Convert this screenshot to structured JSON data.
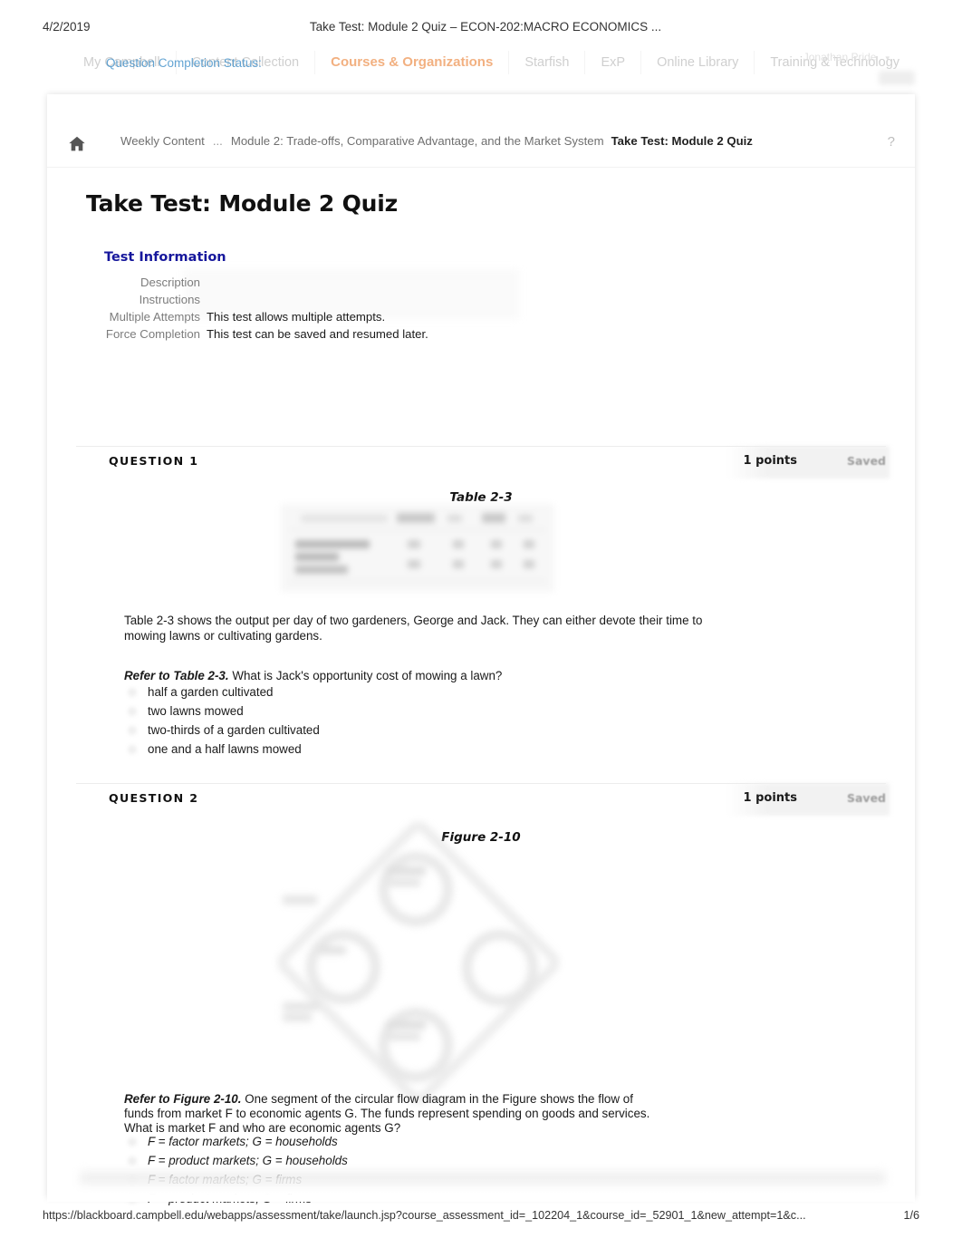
{
  "print_header": {
    "date": "4/2/2019",
    "title": "Take Test: Module 2 Quiz – ECON-202:MACRO ECONOMICS ..."
  },
  "global_nav": {
    "tabs": [
      {
        "label": "My Campbell",
        "active": false
      },
      {
        "label": "Content Collection",
        "active": false
      },
      {
        "label": "Courses & Organizations",
        "active": true
      },
      {
        "label": "Starfish",
        "active": false
      },
      {
        "label": "ExP",
        "active": false
      },
      {
        "label": "Online Library",
        "active": false
      },
      {
        "label": "Training & Technology",
        "active": false
      }
    ],
    "user_name": "Jonathan Pride",
    "user_caret": "▾",
    "overlay_text": "Question Completion Status:"
  },
  "breadcrumb": {
    "home_icon": "home-icon",
    "items": [
      {
        "label": "Weekly Content",
        "current": false
      },
      {
        "label": "...",
        "current": false
      },
      {
        "label": "Module 2: Trade-offs, Comparative Advantage, and the Market System",
        "current": false
      },
      {
        "label": "Take Test: Module 2 Quiz",
        "current": true
      }
    ],
    "help_icon": "?"
  },
  "page_title": "Take Test: Module 2 Quiz",
  "test_information": {
    "heading": "Test Information",
    "rows": [
      {
        "label": "Description",
        "value": ""
      },
      {
        "label": "Instructions",
        "value": ""
      },
      {
        "label": "Multiple Attempts",
        "value": "This test allows multiple attempts."
      },
      {
        "label": "Force Completion",
        "value": "This test can be saved and resumed later."
      }
    ]
  },
  "questions": [
    {
      "label": "QUESTION 1",
      "points": "1 points",
      "status": "Saved",
      "figure_caption": "Table 2-3",
      "intro": "Table 2-3 shows the output per day of two gardeners, George and Jack. They can either devote their time to mowing lawns or cultivating gardens.",
      "stem_prefix": "Refer to Table 2-3.",
      "stem": "What is Jack's opportunity cost of mowing a lawn?",
      "answers": [
        "half a garden cultivated",
        "two lawns mowed",
        "two-thirds of a garden cultivated",
        "one and a half lawns mowed"
      ]
    },
    {
      "label": "QUESTION 2",
      "points": "1 points",
      "status": "Saved",
      "figure_caption": "Figure 2-10",
      "stem_prefix": "Refer to Figure 2-10.",
      "stem_line1": "One segment of the circular flow diagram in the Figure shows the flow of",
      "stem_line2": "funds from market  F to economic agents  G. The funds represent spending on goods and services.",
      "stem_line3": "What is market  F and who are economic agents  G?",
      "answers": [
        "F = factor markets; G = households",
        "F = product markets; G = households",
        "F = factor markets; G = firms",
        "F = product markets; G = firms"
      ]
    }
  ],
  "print_footer": {
    "url": "https://blackboard.campbell.edu/webapps/assessment/take/launch.jsp?course_assessment_id=_102204_1&course_id=_52901_1&new_attempt=1&c...",
    "page": "1/6"
  },
  "colors": {
    "accent_orange": "#e8701a",
    "heading_blue": "#16179c",
    "link_blue": "#2f86c5",
    "muted": "#7c7c7c"
  }
}
